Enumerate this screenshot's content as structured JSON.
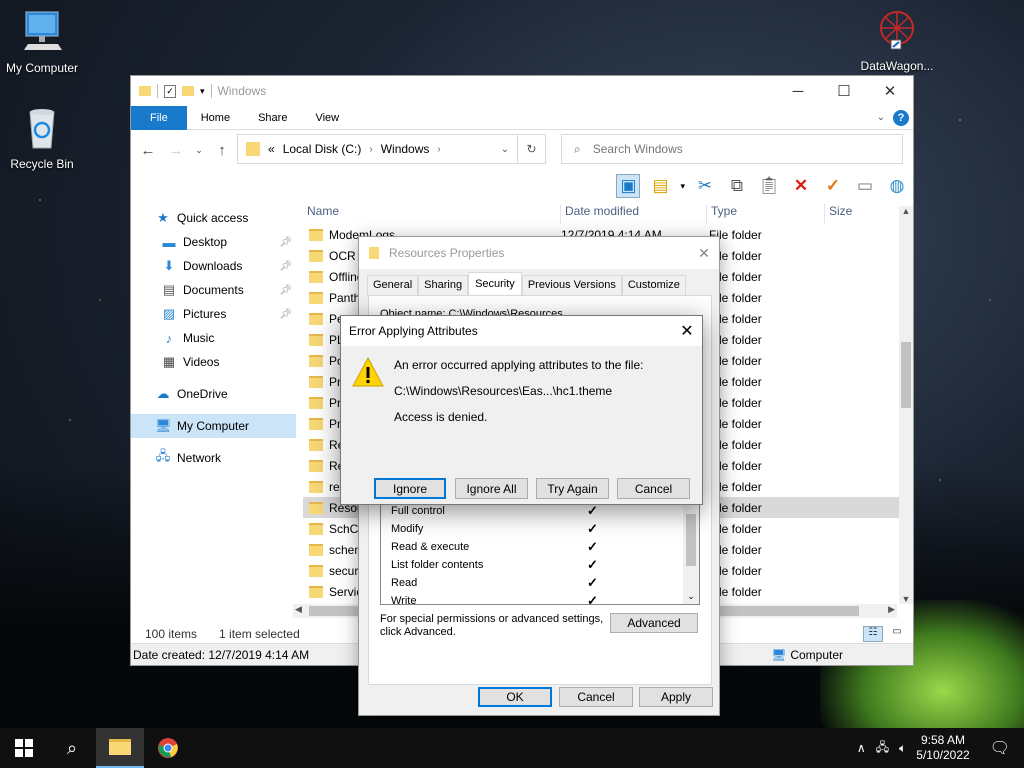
{
  "desktop": {
    "icons": [
      {
        "label": "My Computer"
      },
      {
        "label": "Recycle Bin"
      },
      {
        "label": "DataWagon..."
      }
    ]
  },
  "explorer": {
    "title": "Windows",
    "ribbon_tabs": [
      "File",
      "Home",
      "Share",
      "View"
    ],
    "address": {
      "prefix": "«",
      "segments": [
        "Local Disk (C:)",
        "Windows"
      ]
    },
    "search_placeholder": "Search Windows",
    "nav": {
      "quick_access": "Quick access",
      "pinned": [
        "Desktop",
        "Downloads",
        "Documents",
        "Pictures"
      ],
      "unpinned": [
        "Music",
        "Videos"
      ],
      "onedrive": "OneDrive",
      "my_computer": "My Computer",
      "network": "Network"
    },
    "columns": [
      "Name",
      "Date modified",
      "Type",
      "Size"
    ],
    "rows": [
      {
        "name": "ModemLogs",
        "date": "12/7/2019 4:14 AM",
        "type": "File folder"
      },
      {
        "name": "OCR",
        "date": "",
        "type": "File folder"
      },
      {
        "name": "Offline",
        "date": "",
        "type": "File folder"
      },
      {
        "name": "Panther",
        "date": "",
        "type": "File folder"
      },
      {
        "name": "Pe",
        "date": "",
        "type": "File folder"
      },
      {
        "name": "PL",
        "date": "",
        "type": "File folder"
      },
      {
        "name": "Po",
        "date": "",
        "type": "File folder"
      },
      {
        "name": "Pr",
        "date": "",
        "type": "File folder"
      },
      {
        "name": "Pr",
        "date": "",
        "type": "File folder"
      },
      {
        "name": "Pr",
        "date": "",
        "type": "File folder"
      },
      {
        "name": "Re",
        "date": "",
        "type": "File folder"
      },
      {
        "name": "Re",
        "date": "",
        "type": "File folder"
      },
      {
        "name": "re",
        "date": "",
        "type": "File folder"
      },
      {
        "name": "Resou",
        "date": "",
        "type": "File folder"
      },
      {
        "name": "SchCa",
        "date": "",
        "type": "File folder"
      },
      {
        "name": "schem",
        "date": "",
        "type": "File folder"
      },
      {
        "name": "securi",
        "date": "",
        "type": "File folder"
      },
      {
        "name": "Servic",
        "date": "",
        "type": "File folder"
      }
    ],
    "selected_row_index": 13,
    "status": {
      "count": "100 items",
      "selected": "1 item selected"
    },
    "details": {
      "created": "Date created: 12/7/2019 4:14 AM",
      "location": "Computer"
    }
  },
  "properties": {
    "title": "Resources Properties",
    "tabs": [
      "General",
      "Sharing",
      "Security",
      "Previous Versions",
      "Customize"
    ],
    "active_tab": "Security",
    "object_name": "Object name:    C:\\Windows\\Resources",
    "permissions": [
      {
        "label": "Full control",
        "allow": true
      },
      {
        "label": "Modify",
        "allow": true
      },
      {
        "label": "Read & execute",
        "allow": true
      },
      {
        "label": "List folder contents",
        "allow": true
      },
      {
        "label": "Read",
        "allow": true
      },
      {
        "label": "Write",
        "allow": true
      }
    ],
    "special_note_1": "For special permissions or advanced settings,",
    "special_note_2": "click Advanced.",
    "advanced": "Advanced",
    "ok": "OK",
    "cancel": "Cancel",
    "apply": "Apply"
  },
  "error": {
    "title": "Error Applying Attributes",
    "line1": "An error occurred applying attributes to the file:",
    "path": "C:\\Windows\\Resources\\Eas...\\hc1.theme",
    "line3": "Access is denied.",
    "buttons": [
      "Ignore",
      "Ignore All",
      "Try Again",
      "Cancel"
    ]
  },
  "taskbar": {
    "time": "9:58 AM",
    "date": "5/10/2022"
  },
  "colors": {
    "accent": "#1979ca",
    "folder": "#f8d775",
    "selection": "#cce4f7"
  }
}
